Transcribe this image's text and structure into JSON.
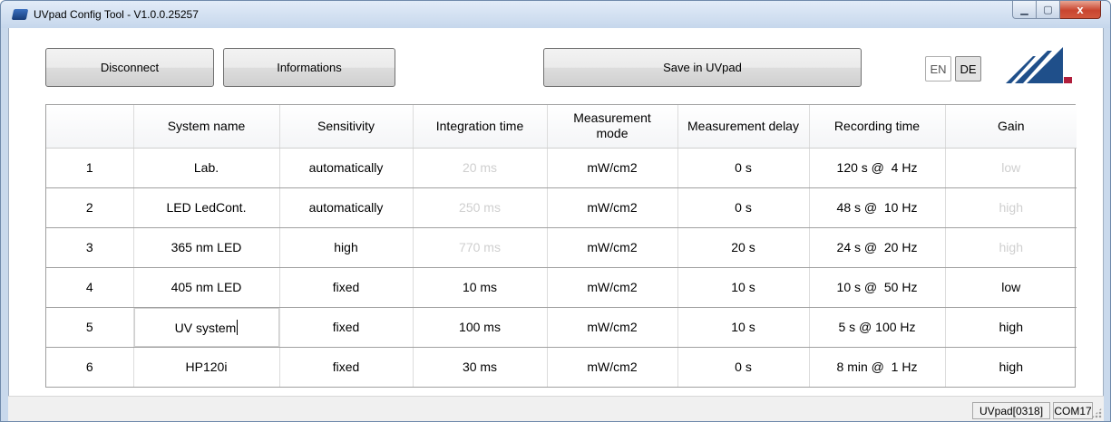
{
  "window": {
    "title": "UVpad Config Tool - V1.0.0.25257",
    "controls": {
      "minimize": "▁",
      "maximize": "▢",
      "close": "x"
    }
  },
  "toolbar": {
    "disconnect_label": "Disconnect",
    "informations_label": "Informations",
    "save_label": "Save in UVpad",
    "lang_en": "EN",
    "lang_de": "DE"
  },
  "table": {
    "headers": {
      "index": "",
      "system_name": "System name",
      "sensitivity": "Sensitivity",
      "integration_time": "Integration time",
      "measurement_mode": "Measurement mode",
      "measurement_delay": "Measurement delay",
      "recording_time": "Recording time",
      "gain": "Gain"
    },
    "rows": [
      {
        "index": "1",
        "system_name": "Lab.",
        "sensitivity": "automatically",
        "integration_time": "20 ms",
        "measurement_mode": "mW/cm2",
        "measurement_delay": "0 s",
        "recording_time": "120 s @  4 Hz",
        "gain": "low"
      },
      {
        "index": "2",
        "system_name": "LED LedCont.",
        "sensitivity": "automatically",
        "integration_time": "250 ms",
        "measurement_mode": "mW/cm2",
        "measurement_delay": "0 s",
        "recording_time": "48 s @  10 Hz",
        "gain": "high"
      },
      {
        "index": "3",
        "system_name": "365 nm LED",
        "sensitivity": "high",
        "integration_time": "770 ms",
        "measurement_mode": "mW/cm2",
        "measurement_delay": "20 s",
        "recording_time": "24 s @  20 Hz",
        "gain": "high"
      },
      {
        "index": "4",
        "system_name": "405 nm LED",
        "sensitivity": "fixed",
        "integration_time": "10 ms",
        "measurement_mode": "mW/cm2",
        "measurement_delay": "10 s",
        "recording_time": "10 s @  50 Hz",
        "gain": "low"
      },
      {
        "index": "5",
        "system_name": "UV system",
        "sensitivity": "fixed",
        "integration_time": "100 ms",
        "measurement_mode": "mW/cm2",
        "measurement_delay": "10 s",
        "recording_time": "5 s @ 100 Hz",
        "gain": "high"
      },
      {
        "index": "6",
        "system_name": "HP120i",
        "sensitivity": "fixed",
        "integration_time": "30 ms",
        "measurement_mode": "mW/cm2",
        "measurement_delay": "0 s",
        "recording_time": "8 min @  1 Hz",
        "gain": "high"
      }
    ]
  },
  "statusbar": {
    "device": "UVpad[0318]",
    "port": "COM17"
  },
  "colors": {
    "disabled_text": "#cfcfcf",
    "logo_blue": "#1f4f8a",
    "logo_red": "#b01e3c"
  }
}
